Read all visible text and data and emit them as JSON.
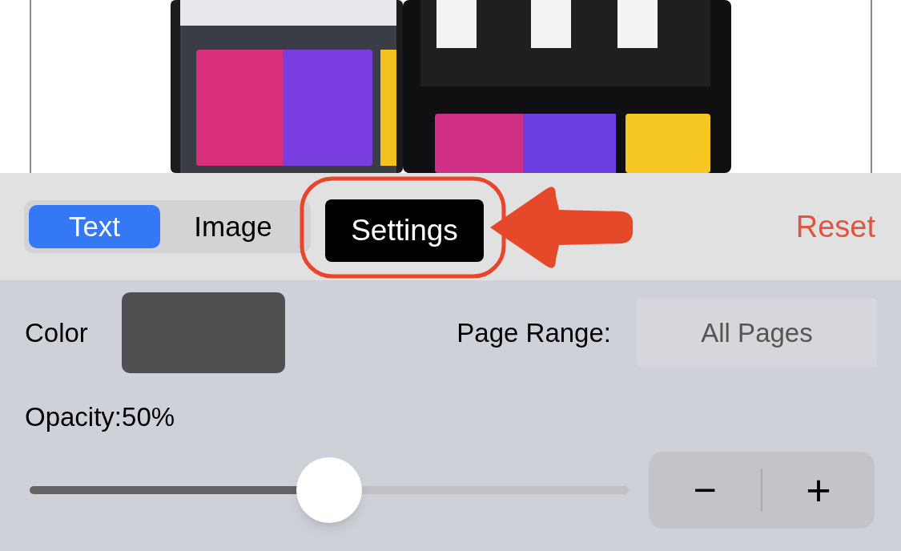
{
  "tabs": [
    {
      "label": "Text",
      "selected": true
    },
    {
      "label": "Image",
      "selected": false
    }
  ],
  "settings_button": {
    "label": "Settings"
  },
  "reset_button": {
    "label": "Reset"
  },
  "color": {
    "label": "Color"
  },
  "page_range": {
    "label": "Page Range:",
    "value": "All Pages"
  },
  "opacity": {
    "label": "Opacity:50%",
    "level": 0.5
  },
  "stepper": {
    "minus": "−",
    "plus": "+"
  }
}
